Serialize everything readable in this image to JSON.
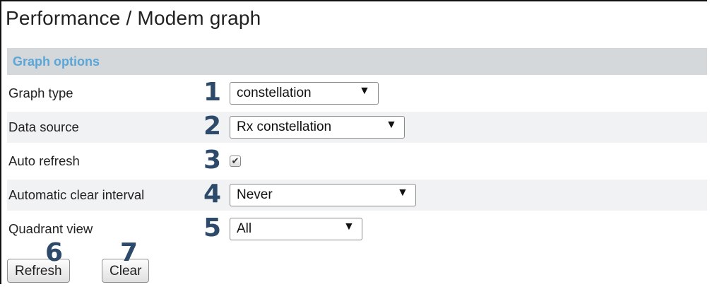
{
  "page": {
    "title": "Performance / Modem graph"
  },
  "section": {
    "title": "Graph options"
  },
  "rows": {
    "graph_type": {
      "label": "Graph type",
      "number": "1",
      "value": "constellation"
    },
    "data_source": {
      "label": "Data source",
      "number": "2",
      "value": "Rx constellation"
    },
    "auto_refresh": {
      "label": "Auto refresh",
      "number": "3",
      "checked": true,
      "checkmark": "✔"
    },
    "clear_interval": {
      "label": "Automatic clear interval",
      "number": "4",
      "value": "Never"
    },
    "quadrant_view": {
      "label": "Quadrant view",
      "number": "5",
      "value": "All"
    }
  },
  "buttons": {
    "refresh": {
      "label": "Refresh",
      "number": "6"
    },
    "clear": {
      "label": "Clear",
      "number": "7"
    }
  },
  "icons": {
    "dropdown": "▼"
  },
  "colors": {
    "header_bg": "#d5d8da",
    "header_text": "#5aa6d8",
    "callout_number": "#2e4a6b"
  }
}
